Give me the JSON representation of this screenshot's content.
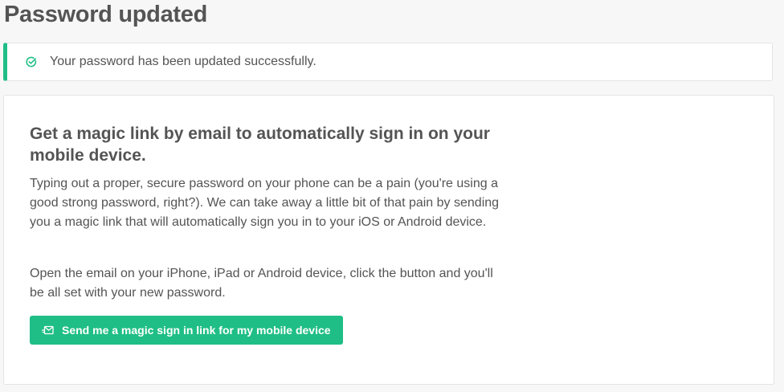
{
  "page": {
    "title": "Password updated"
  },
  "alert": {
    "icon": "check-circle-icon",
    "message": "Your password has been updated successfully.",
    "accent_color": "#1fbe86"
  },
  "magic_link": {
    "heading": "Get a magic link by email to automatically sign in on your mobile device.",
    "paragraph1": "Typing out a proper, secure password on your phone can be a pain (you're using a good strong password, right?). We can take away a little bit of that pain by sending you a magic link that will automatically sign you in to your iOS or Android device.",
    "paragraph2": "Open the email on your iPhone, iPad or Android device, click the button and you'll be all set with your new password.",
    "button_label": "Send me a magic sign in link for my mobile device",
    "button_icon": "send-email-icon",
    "button_color": "#1fbe86"
  }
}
